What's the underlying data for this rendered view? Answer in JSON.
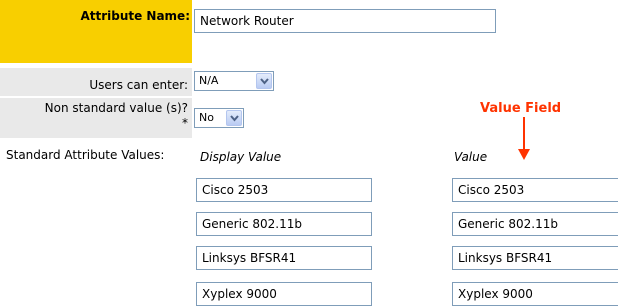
{
  "attribute": {
    "name_label": "Attribute Name:",
    "name_value": "Network Router"
  },
  "users_can_enter": {
    "label": "Users can enter:",
    "selected": "N/A"
  },
  "non_standard": {
    "label": "Non standard value (s)? *",
    "selected": "No"
  },
  "annotation": {
    "label": "Value Field",
    "color": "#ff3300"
  },
  "standard_values": {
    "label": "Standard Attribute Values:",
    "display_header": "Display Value",
    "value_header": "Value",
    "rows": [
      {
        "display": "Cisco 2503",
        "value": "Cisco 2503"
      },
      {
        "display": "Generic 802.11b",
        "value": "Generic 802.11b"
      },
      {
        "display": "Linksys BFSR41",
        "value": "Linksys BFSR41"
      },
      {
        "display": "Xyplex 9000",
        "value": "Xyplex 9000"
      }
    ]
  },
  "colors": {
    "label_highlight": "#f8cf00",
    "label_background": "#e9e9e9"
  }
}
